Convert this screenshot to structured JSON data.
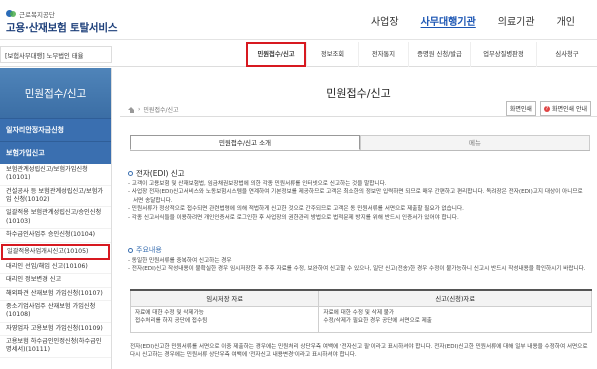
{
  "header": {
    "logo_sub": "근로복지공단",
    "logo_part1": "고용",
    "logo_dot": "·",
    "logo_part2": "산재보험 토탈서비스",
    "gnb": [
      {
        "label": "사업장",
        "active": false
      },
      {
        "label": "사무대행기관",
        "active": true
      },
      {
        "label": "의료기관",
        "active": false
      },
      {
        "label": "개인",
        "active": false
      }
    ]
  },
  "subbar": {
    "service_select": "[보험사무대행] 노무법인 태율",
    "tabs": [
      {
        "label": "민원접수/신고",
        "active": true
      },
      {
        "label": "정보조회",
        "active": false
      },
      {
        "label": "전자통지",
        "active": false
      },
      {
        "label": "증명원 신청/발급",
        "active": false
      },
      {
        "label": "업무상질병판정",
        "active": false
      },
      {
        "label": "심사청구",
        "active": false
      }
    ]
  },
  "sidebar": {
    "title": "민원접수/신고",
    "group1": "일자리안정자금신청",
    "group2": "보험가입신고",
    "items": [
      {
        "label": "보험관계성립신고/보험가입신청(10101)",
        "highlight": false
      },
      {
        "label": "건설공사 등 보험관계성립신고/보험가입 신청(10102)",
        "highlight": false
      },
      {
        "label": "일괄적용 보험관계성립신고/승인신청(10103)",
        "highlight": false
      },
      {
        "label": "하수급인사업주 승인신청(10104)",
        "highlight": false
      },
      {
        "label": "일괄적용사업개시신고(10105)",
        "highlight": true
      },
      {
        "label": "대리인 선임/해임 신고(10106)",
        "highlight": false
      },
      {
        "label": "대리인 정보변경 신고",
        "highlight": false
      },
      {
        "label": "해외파견 산재보험 가입신청(10107)",
        "highlight": false
      },
      {
        "label": "중소기업사업주 산재보험 가입신청(10108)",
        "highlight": false
      },
      {
        "label": "자영업자 고용보험 가입신청(10109)",
        "highlight": false
      },
      {
        "label": "고용보험 하수급인인정신청(하수급인 명세서)(10111)",
        "highlight": false
      }
    ]
  },
  "main": {
    "page_title": "민원접수/신고",
    "breadcrumb": "민원접수/신고",
    "print_label": "화면인쇄",
    "help_label": "화면인쇄 안내",
    "content_tabs": [
      {
        "label": "민원접수/신고 소개",
        "active": true
      },
      {
        "label": "메뉴",
        "active": false
      }
    ],
    "edi_title": "전자(EDI) 신고",
    "edi_paras": [
      "고객이 고용보험 및 산재보험법, 임금채권보장법에 의한 각종 민원서류를 인터넷으로 신고하는 것을 말합니다.",
      "사업장 전자(EDI)신고서비스와 노동보험시스템을 연계하여 기본정보를 제공하므로 고객은 최소한의 정보만 입력하면 되므로 매우 간편하고 편리합니다. 독려장은 전자(EDI)고지 대상이 아니므로 서면 송달합니다.",
      "민원서류가 정상적으로 접수되면 관련법령에 의해 적법하게 신고한 것으로 간주되므로 고객은 동 민원서류를 서면으로 제출할 필요가 없습니다.",
      "각종 신고서식들을 이용하려면 개인인증서로 로그인한 후 사업장의 권한관리 방법으로 법적문제 방지를 위해 반드시 인증서가 있어야 합니다."
    ],
    "notes_title": "주요내용",
    "notes_paras": [
      "동일한 민원서류를 중복하여 신고하는 경우",
      "전자(EDI)신고 작성내용이 불확실한 경우 임시저장한 후 추후 자료를 수정, 보완하여 신고할 수 있으나, 일단 신고(전송)한 경우 수정이 불가능하니 신고시 반드시 작성내용을 확인하시기 바랍니다."
    ],
    "table": {
      "headers": [
        "임시저장 자료",
        "신고(신청)자료"
      ],
      "rows": [
        [
          "자료에 대한 수정 및 삭제가능\n접수처리를 하지 공단에 접수됨",
          "자료에 대한 수정 및 삭제 불가\n수정/삭제가 필요한 경우 공단에 서면으로 제출"
        ]
      ]
    },
    "footnote": "전자(EDI)신고한 민원서류를 서면으로 이중 제출하는 경우에는 민원처리 상단우측 여백에 '전자신고 필'이라고 표시하셔야 합니다. 전자(EDI)신고한 민원서류에 대해 일부 내용을 수정하여 서면으로 다시 신고하는 경우에는 민원서류 상단우측 여백에 '전자신고 내용변경'이라고 표시하셔야 합니다."
  }
}
